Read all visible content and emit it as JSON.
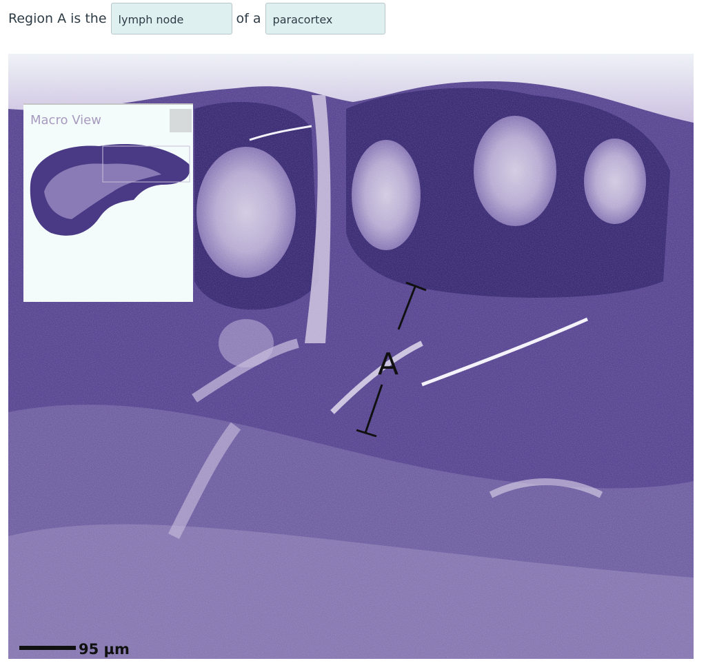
{
  "question": {
    "prefix": "Region A is the",
    "blank1_value": "lymph node",
    "connector": "of a",
    "blank2_value": "paracortex"
  },
  "image": {
    "macro_view_title": "Macro View",
    "region_label": "A",
    "scale_label": "95 µm"
  },
  "colors": {
    "tissue_dark": "#3c2d75",
    "tissue_mid": "#5c4a94",
    "tissue_light": "#c0b5d4",
    "answer_box_bg": "#dff0f0"
  }
}
